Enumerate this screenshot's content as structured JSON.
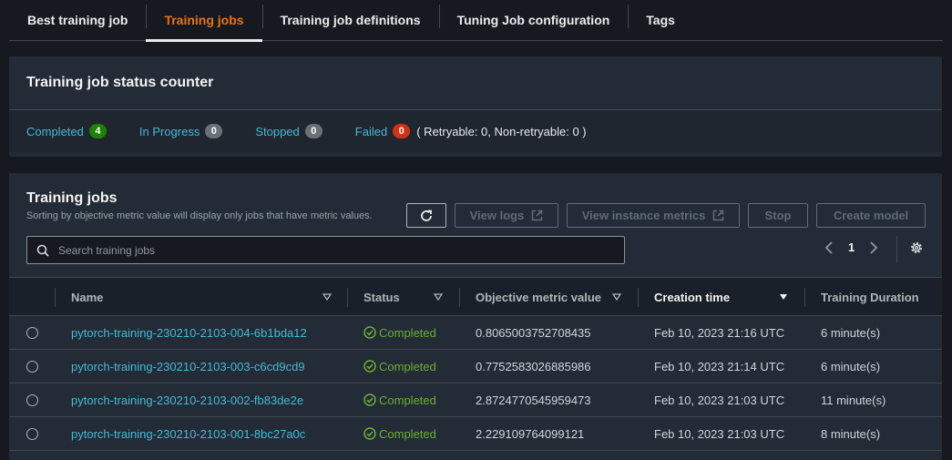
{
  "tabs": [
    {
      "label": "Best training job"
    },
    {
      "label": "Training jobs"
    },
    {
      "label": "Training job definitions"
    },
    {
      "label": "Tuning Job configuration"
    },
    {
      "label": "Tags"
    }
  ],
  "active_tab": "Training jobs",
  "status_counter": {
    "title": "Training job status counter",
    "completed": {
      "label": "Completed",
      "count": "4"
    },
    "in_progress": {
      "label": "In Progress",
      "count": "0"
    },
    "stopped": {
      "label": "Stopped",
      "count": "0"
    },
    "failed": {
      "label": "Failed",
      "count": "0"
    },
    "retry_note": "( Retryable: 0, Non-retryable: 0 )"
  },
  "jobs": {
    "title": "Training jobs",
    "subtitle": "Sorting by objective metric value will display only jobs that have metric values.",
    "buttons": {
      "view_logs": "View logs",
      "view_metrics": "View instance metrics",
      "stop": "Stop",
      "create_model": "Create model"
    },
    "search_placeholder": "Search training jobs",
    "page": "1",
    "columns": {
      "name": "Name",
      "status": "Status",
      "metric": "Objective metric value",
      "created": "Creation time",
      "duration": "Training Duration"
    },
    "rows": [
      {
        "name": "pytorch-training-230210-2103-004-6b1bda12",
        "status": "Completed",
        "metric": "0.8065003752708435",
        "created": "Feb 10, 2023 21:16 UTC",
        "duration": "6 minute(s)"
      },
      {
        "name": "pytorch-training-230210-2103-003-c6cd9cd9",
        "status": "Completed",
        "metric": "0.7752583026885986",
        "created": "Feb 10, 2023 21:14 UTC",
        "duration": "6 minute(s)"
      },
      {
        "name": "pytorch-training-230210-2103-002-fb83de2e",
        "status": "Completed",
        "metric": "2.8724770545959473",
        "created": "Feb 10, 2023 21:03 UTC",
        "duration": "11 minute(s)"
      },
      {
        "name": "pytorch-training-230210-2103-001-8bc27a0c",
        "status": "Completed",
        "metric": "2.229109764099121",
        "created": "Feb 10, 2023 21:03 UTC",
        "duration": "8 minute(s)"
      }
    ]
  },
  "colors": {
    "accent": "#ec7211",
    "link": "#44b9d6",
    "success": "#6aaf35",
    "badge_green": "#1d8102",
    "badge_red": "#d13212",
    "badge_grey": "#687078"
  }
}
